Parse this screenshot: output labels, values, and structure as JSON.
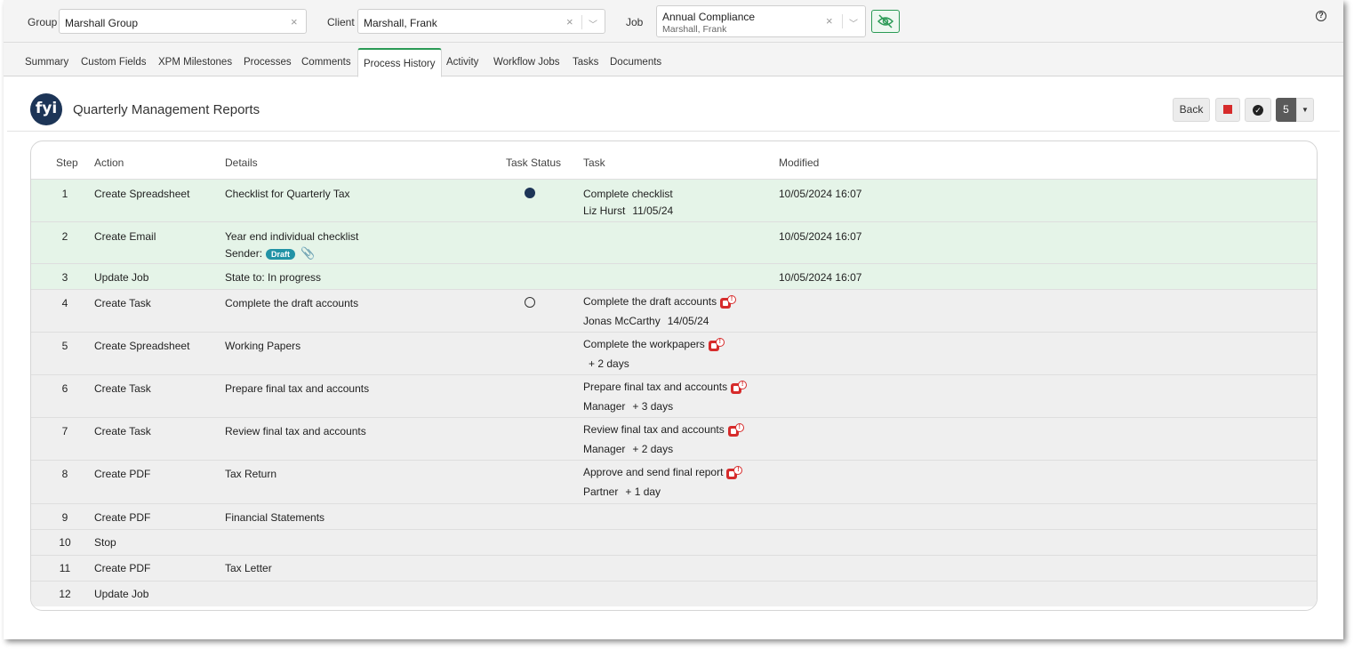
{
  "filters": {
    "group": {
      "label": "Group",
      "value": "Marshall Group"
    },
    "client": {
      "label": "Client",
      "value": "Marshall, Frank"
    },
    "job": {
      "label": "Job",
      "value": "Annual Compliance",
      "subvalue": "Marshall, Frank"
    },
    "clear_icon": "close-icon",
    "help_label": "?"
  },
  "tabs": [
    "Summary",
    "Custom Fields",
    "XPM Milestones",
    "Processes",
    "Comments",
    "Process History",
    "Activity",
    "Workflow Jobs",
    "Tasks",
    "Documents"
  ],
  "active_tab": "Process History",
  "header": {
    "logo_text": "fyi",
    "title": "Quarterly Management Reports",
    "back_label": "Back",
    "count": "5"
  },
  "table": {
    "columns": {
      "step": "Step",
      "action": "Action",
      "details": "Details",
      "task_status": "Task Status",
      "task": "Task",
      "modified": "Modified"
    },
    "rows": [
      {
        "step": "1",
        "action": "Create Spreadsheet",
        "details": "Checklist for Quarterly Tax",
        "status": "complete",
        "task": "Complete checklist",
        "task_assignee": "Liz Hurst",
        "task_due": "11/05/24",
        "modified": "10/05/2024 16:07"
      },
      {
        "step": "2",
        "action": "Create Email",
        "details": "Year end individual checklist",
        "details_sub_label": "Sender:",
        "details_badge": "Draft",
        "modified": "10/05/2024 16:07"
      },
      {
        "step": "3",
        "action": "Update Job",
        "details": "State to:  In progress",
        "modified": "10/05/2024 16:07"
      },
      {
        "step": "4",
        "action": "Create Task",
        "details": "Complete the draft accounts",
        "status": "pending",
        "task": "Complete the draft accounts",
        "task_assignee": "Jonas McCarthy",
        "task_due": "14/05/24"
      },
      {
        "step": "5",
        "action": "Create Spreadsheet",
        "details": "Working Papers",
        "task": "Complete the workpapers",
        "task_assignee": "",
        "task_due": "+ 2 days"
      },
      {
        "step": "6",
        "action": "Create Task",
        "details": "Prepare final tax and accounts",
        "task": "Prepare final tax and accounts",
        "task_assignee": "Manager",
        "task_due": "+ 3 days"
      },
      {
        "step": "7",
        "action": "Create Task",
        "details": "Review final tax and accounts",
        "task": "Review final tax and accounts",
        "task_assignee": "Manager",
        "task_due": "+ 2 days"
      },
      {
        "step": "8",
        "action": "Create PDF",
        "details": "Tax Return",
        "task": "Approve and send final report",
        "task_assignee": "Partner",
        "task_due": "+ 1 day"
      },
      {
        "step": "9",
        "action": "Create PDF",
        "details": "Financial Statements"
      },
      {
        "step": "10",
        "action": "Stop",
        "details": ""
      },
      {
        "step": "11",
        "action": "Create PDF",
        "details": "Tax Letter"
      },
      {
        "step": "12",
        "action": "Update Job",
        "details": ""
      }
    ]
  }
}
